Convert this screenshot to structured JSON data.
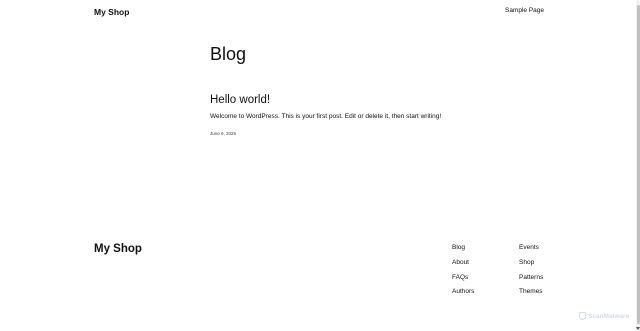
{
  "header": {
    "site_title": "My Shop",
    "nav_items": [
      "Sample Page"
    ]
  },
  "main": {
    "page_heading": "Blog",
    "posts": [
      {
        "title": "Hello world!",
        "excerpt": "Welcome to WordPress. This is your first post. Edit or delete it, then start writing!",
        "date": "June 9, 2025"
      }
    ]
  },
  "footer": {
    "site_title": "My Shop",
    "column_1": [
      "Blog",
      "About",
      "FAQs",
      "Authors"
    ],
    "column_2": [
      "Events",
      "Shop",
      "Patterns",
      "Themes"
    ]
  },
  "watermark": {
    "text": "ScanMalware",
    "icon": "shield-icon"
  }
}
